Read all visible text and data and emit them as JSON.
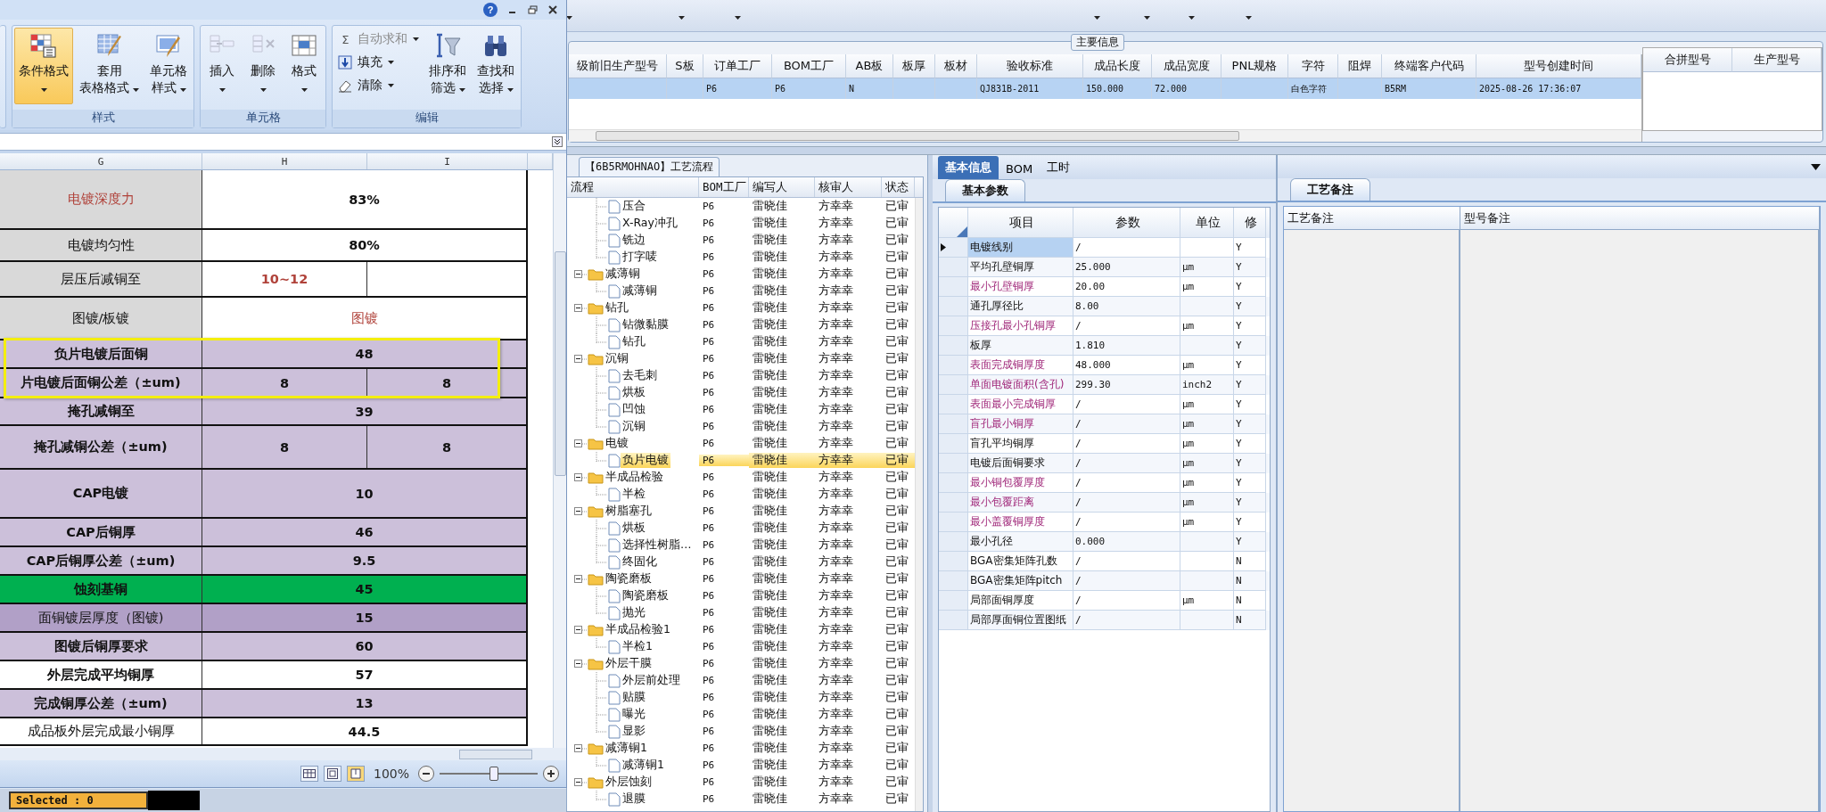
{
  "main": {
    "group_title": "主要信息",
    "columns": [
      {
        "header": "级前旧生产型号"
      },
      {
        "header": "S板"
      },
      {
        "header": "订单工厂",
        "value": "P6"
      },
      {
        "header": "BOM工厂",
        "value": "P6"
      },
      {
        "header": "AB板",
        "value": "N"
      },
      {
        "header": "板厚"
      },
      {
        "header": "板材"
      },
      {
        "header": "验收标准",
        "value": "QJ831B-2011"
      },
      {
        "header": "成品长度",
        "value": "150.000"
      },
      {
        "header": "成品宽度",
        "value": "72.000"
      },
      {
        "header": "PNL规格"
      },
      {
        "header": "字符",
        "value": "白色字符"
      },
      {
        "header": "阻焊"
      },
      {
        "header": "终端客户代码",
        "value": "B5RM"
      },
      {
        "header": "型号创建时间",
        "value": "2025-08-26 17:36:07"
      }
    ],
    "data_row_selected": true,
    "side_columns": [
      "合拼型号",
      "生产型号"
    ],
    "status_text": "Selected : 0"
  },
  "tree": {
    "tab": "【6B5RMOHNAO】工艺流程",
    "columns": [
      "流程",
      "BOM工厂",
      "编写人",
      "核审人",
      "状态"
    ],
    "leading_children": [
      {
        "label": "压合",
        "bom": "P6",
        "writer": "雷晓佳",
        "reviewer": "方幸幸",
        "status": "已审",
        "selected": false
      },
      {
        "label": "X-Ray冲孔",
        "bom": "P6",
        "writer": "雷晓佳",
        "reviewer": "方幸幸",
        "status": "已审",
        "selected": false
      },
      {
        "label": "铣边",
        "bom": "P6",
        "writer": "雷晓佳",
        "reviewer": "方幸幸",
        "status": "已审",
        "selected": false
      },
      {
        "label": "打字唛",
        "bom": "P6",
        "writer": "雷晓佳",
        "reviewer": "方幸幸",
        "status": "已审",
        "selected": false
      }
    ],
    "nodes": [
      {
        "label": "减薄铜",
        "bom": "P6",
        "writer": "雷晓佳",
        "reviewer": "方幸幸",
        "status": "已审",
        "selected": false,
        "expanded": true,
        "children": [
          {
            "label": "减薄铜",
            "bom": "P6",
            "writer": "雷晓佳",
            "reviewer": "方幸幸",
            "status": "已审",
            "selected": false
          }
        ]
      },
      {
        "label": "钻孔",
        "bom": "P6",
        "writer": "雷晓佳",
        "reviewer": "方幸幸",
        "status": "已审",
        "selected": false,
        "expanded": true,
        "children": [
          {
            "label": "钻微黏膜",
            "bom": "P6",
            "writer": "雷晓佳",
            "reviewer": "方幸幸",
            "status": "已审",
            "selected": false
          },
          {
            "label": "钻孔",
            "bom": "P6",
            "writer": "雷晓佳",
            "reviewer": "方幸幸",
            "status": "已审",
            "selected": false
          }
        ]
      },
      {
        "label": "沉铜",
        "bom": "P6",
        "writer": "雷晓佳",
        "reviewer": "方幸幸",
        "status": "已审",
        "selected": false,
        "expanded": true,
        "children": [
          {
            "label": "去毛刺",
            "bom": "P6",
            "writer": "雷晓佳",
            "reviewer": "方幸幸",
            "status": "已审",
            "selected": false
          },
          {
            "label": "烘板",
            "bom": "P6",
            "writer": "雷晓佳",
            "reviewer": "方幸幸",
            "status": "已审",
            "selected": false
          },
          {
            "label": "凹蚀",
            "bom": "P6",
            "writer": "雷晓佳",
            "reviewer": "方幸幸",
            "status": "已审",
            "selected": false
          },
          {
            "label": "沉铜",
            "bom": "P6",
            "writer": "雷晓佳",
            "reviewer": "方幸幸",
            "status": "已审",
            "selected": false
          }
        ]
      },
      {
        "label": "电镀",
        "bom": "P6",
        "writer": "雷晓佳",
        "reviewer": "方幸幸",
        "status": "已审",
        "selected": false,
        "expanded": true,
        "children": [
          {
            "label": "负片电镀",
            "bom": "P6",
            "writer": "雷晓佳",
            "reviewer": "方幸幸",
            "status": "已审",
            "selected": true
          }
        ]
      },
      {
        "label": "半成品检验",
        "bom": "P6",
        "writer": "雷晓佳",
        "reviewer": "方幸幸",
        "status": "已审",
        "selected": false,
        "expanded": true,
        "children": [
          {
            "label": "半检",
            "bom": "P6",
            "writer": "雷晓佳",
            "reviewer": "方幸幸",
            "status": "已审",
            "selected": false
          }
        ]
      },
      {
        "label": "树脂塞孔",
        "bom": "P6",
        "writer": "雷晓佳",
        "reviewer": "方幸幸",
        "status": "已审",
        "selected": false,
        "expanded": true,
        "children": [
          {
            "label": "烘板",
            "bom": "P6",
            "writer": "雷晓佳",
            "reviewer": "方幸幸",
            "status": "已审",
            "selected": false
          },
          {
            "label": "选择性树脂…",
            "bom": "P6",
            "writer": "雷晓佳",
            "reviewer": "方幸幸",
            "status": "已审",
            "selected": false
          },
          {
            "label": "终固化",
            "bom": "P6",
            "writer": "雷晓佳",
            "reviewer": "方幸幸",
            "status": "已审",
            "selected": false
          }
        ]
      },
      {
        "label": "陶瓷磨板",
        "bom": "P6",
        "writer": "雷晓佳",
        "reviewer": "方幸幸",
        "status": "已审",
        "selected": false,
        "expanded": true,
        "children": [
          {
            "label": "陶瓷磨板",
            "bom": "P6",
            "writer": "雷晓佳",
            "reviewer": "方幸幸",
            "status": "已审",
            "selected": false
          },
          {
            "label": "抛光",
            "bom": "P6",
            "writer": "雷晓佳",
            "reviewer": "方幸幸",
            "status": "已审",
            "selected": false
          }
        ]
      },
      {
        "label": "半成品检验1",
        "bom": "P6",
        "writer": "雷晓佳",
        "reviewer": "方幸幸",
        "status": "已审",
        "selected": false,
        "expanded": true,
        "children": [
          {
            "label": "半检1",
            "bom": "P6",
            "writer": "雷晓佳",
            "reviewer": "方幸幸",
            "status": "已审",
            "selected": false
          }
        ]
      },
      {
        "label": "外层干膜",
        "bom": "P6",
        "writer": "雷晓佳",
        "reviewer": "方幸幸",
        "status": "已审",
        "selected": false,
        "expanded": true,
        "children": [
          {
            "label": "外层前处理",
            "bom": "P6",
            "writer": "雷晓佳",
            "reviewer": "方幸幸",
            "status": "已审",
            "selected": false
          },
          {
            "label": "贴膜",
            "bom": "P6",
            "writer": "雷晓佳",
            "reviewer": "方幸幸",
            "status": "已审",
            "selected": false
          },
          {
            "label": "曝光",
            "bom": "P6",
            "writer": "雷晓佳",
            "reviewer": "方幸幸",
            "status": "已审",
            "selected": false
          },
          {
            "label": "显影",
            "bom": "P6",
            "writer": "雷晓佳",
            "reviewer": "方幸幸",
            "status": "已审",
            "selected": false
          }
        ]
      },
      {
        "label": "减薄铜1",
        "bom": "P6",
        "writer": "雷晓佳",
        "reviewer": "方幸幸",
        "status": "已审",
        "selected": false,
        "expanded": true,
        "children": [
          {
            "label": "减薄铜1",
            "bom": "P6",
            "writer": "雷晓佳",
            "reviewer": "方幸幸",
            "status": "已审",
            "selected": false
          }
        ]
      },
      {
        "label": "外层蚀刻",
        "bom": "P6",
        "writer": "雷晓佳",
        "reviewer": "方幸幸",
        "status": "已审",
        "selected": false,
        "expanded": true,
        "children": [
          {
            "label": "退膜",
            "bom": "P6",
            "writer": "雷晓佳",
            "reviewer": "方幸幸",
            "status": "已审",
            "selected": false
          }
        ]
      }
    ]
  },
  "info": {
    "tabs": [
      {
        "label": "基本信息",
        "selected": true
      },
      {
        "label": "BOM",
        "selected": false
      },
      {
        "label": "工时",
        "selected": false
      }
    ],
    "subtab": "基本参数",
    "columns": [
      "项目",
      "参数",
      "单位",
      "修"
    ],
    "rows": [
      {
        "item": "电镀线别",
        "value": "/",
        "modify": "Y",
        "highlighted": false,
        "selected": true
      },
      {
        "item": "平均孔壁铜厚",
        "value": "25.000",
        "unit": "μm",
        "modify": "Y",
        "highlighted": false,
        "selected": false
      },
      {
        "item": "最小孔壁铜厚",
        "value": "20.00",
        "unit": "μm",
        "modify": "Y",
        "highlighted": true,
        "selected": false
      },
      {
        "item": "通孔厚径比",
        "value": "8.00",
        "modify": "Y",
        "highlighted": false,
        "selected": false
      },
      {
        "item": "压接孔最小孔铜厚",
        "value": "/",
        "unit": "μm",
        "modify": "Y",
        "highlighted": true,
        "selected": false
      },
      {
        "item": "板厚",
        "value": "1.810",
        "modify": "Y",
        "highlighted": false,
        "selected": false
      },
      {
        "item": "表面完成铜厚度",
        "value": "48.000",
        "unit": "μm",
        "modify": "Y",
        "highlighted": true,
        "selected": false
      },
      {
        "item": "单面电镀面积(含孔)",
        "value": "299.30",
        "unit": "inch2",
        "modify": "Y",
        "highlighted": true,
        "selected": false
      },
      {
        "item": "表面最小完成铜厚",
        "value": "/",
        "unit": "μm",
        "modify": "Y",
        "highlighted": true,
        "selected": false
      },
      {
        "item": "盲孔最小铜厚",
        "value": "/",
        "unit": "μm",
        "modify": "Y",
        "highlighted": true,
        "selected": false
      },
      {
        "item": "盲孔平均铜厚",
        "value": "/",
        "unit": "μm",
        "modify": "Y",
        "highlighted": false,
        "selected": false
      },
      {
        "item": "电镀后面铜要求",
        "value": "/",
        "unit": "μm",
        "modify": "Y",
        "highlighted": false,
        "selected": false
      },
      {
        "item": "最小铜包覆厚度",
        "value": "/",
        "unit": "μm",
        "modify": "Y",
        "highlighted": true,
        "selected": false
      },
      {
        "item": "最小包覆距离",
        "value": "/",
        "unit": "μm",
        "modify": "Y",
        "highlighted": true,
        "selected": false
      },
      {
        "item": "最小盖覆铜厚度",
        "value": "/",
        "unit": "μm",
        "modify": "Y",
        "highlighted": true,
        "selected": false
      },
      {
        "item": "最小孔径",
        "value": "0.000",
        "modify": "Y",
        "highlighted": false,
        "selected": false
      },
      {
        "item": "BGA密集矩阵孔数",
        "value": "/",
        "modify": "N",
        "highlighted": false,
        "selected": false
      },
      {
        "item": "BGA密集矩阵pitch",
        "value": "/",
        "modify": "N",
        "highlighted": false,
        "selected": false
      },
      {
        "item": "局部面铜厚度",
        "value": "/",
        "unit": "μm",
        "modify": "N",
        "highlighted": false,
        "selected": false
      },
      {
        "item": "局部厚面铜位置图纸",
        "value": "/",
        "modify": "N",
        "highlighted": false,
        "selected": false
      }
    ]
  },
  "notes": {
    "tab": "工艺备注",
    "columns": [
      "工艺备注",
      "型号备注"
    ]
  },
  "excel": {
    "help_glyph": "?",
    "groups": [
      {
        "label": "样式",
        "buttons": [
          {
            "lines": [
              "条件格式"
            ],
            "active": true
          },
          {
            "lines": [
              "套用",
              "表格格式"
            ],
            "active": false
          },
          {
            "lines": [
              "单元格",
              "样式"
            ],
            "active": false
          }
        ]
      },
      {
        "label": "单元格",
        "buttons": [
          {
            "lines": [
              "插入"
            ],
            "active": false
          },
          {
            "lines": [
              "删除"
            ],
            "active": false
          },
          {
            "lines": [
              "格式"
            ],
            "active": false
          }
        ]
      },
      {
        "label": "编辑",
        "small": [
          {
            "glyph": "Σ",
            "label": "自动求和",
            "disabled": true
          },
          {
            "label": "填充",
            "disabled": false
          },
          {
            "label": "清除",
            "disabled": false
          }
        ],
        "buttons": [
          {
            "lines": [
              "排序和",
              "筛选"
            ],
            "active": false
          },
          {
            "lines": [
              "查找和",
              "选择"
            ],
            "active": false
          }
        ]
      }
    ],
    "sheet": {
      "columns": [
        "G",
        "H",
        "I"
      ],
      "rows": [
        {
          "label": "电镀深度力",
          "kind": "merged",
          "values": [
            "83%"
          ],
          "color": "#ffffff",
          "shaded_label": true,
          "bold": false,
          "label_red": true,
          "value_red": false,
          "value_bold": true
        },
        {
          "label": "电镀均匀性",
          "kind": "merged",
          "values": [
            "80%"
          ],
          "color": "#ffffff",
          "shaded_label": true,
          "bold": false,
          "label_red": false,
          "value_red": false,
          "value_bold": true
        },
        {
          "label": "层压后减铜至",
          "kind": "split",
          "values": [
            "10~12"
          ],
          "color": "#ffffff",
          "shaded_label": true,
          "bold": false,
          "label_red": false,
          "value_red": true,
          "value_bold": true
        },
        {
          "label": "图镀/板镀",
          "kind": "merged",
          "values": [
            "图镀"
          ],
          "color": "#ffffff",
          "shaded_label": true,
          "bold": false,
          "label_red": false,
          "value_red": true,
          "value_bold": false
        },
        {
          "label": "负片电镀后面铜",
          "kind": "merged",
          "values": [
            "48"
          ],
          "color": "#ccc0da",
          "shaded_label": false,
          "bold": true,
          "label_red": false,
          "value_red": false,
          "value_bold": true
        },
        {
          "label": "片电镀后面铜公差（±um)",
          "kind": "split",
          "values": [
            "8",
            "8"
          ],
          "color": "#ccc0da",
          "shaded_label": false,
          "bold": true,
          "label_red": false,
          "value_red": false,
          "value_bold": true
        },
        {
          "label": "掩孔减铜至",
          "kind": "merged",
          "values": [
            "39"
          ],
          "color": "#ccc0da",
          "shaded_label": false,
          "bold": true,
          "label_red": false,
          "value_red": false,
          "value_bold": true
        },
        {
          "label": "掩孔减铜公差（±um)",
          "kind": "split",
          "values": [
            "8",
            "8"
          ],
          "color": "#ccc0da",
          "shaded_label": false,
          "bold": true,
          "label_red": false,
          "value_red": false,
          "value_bold": true
        },
        {
          "label": "CAP电镀",
          "kind": "merged",
          "values": [
            "10"
          ],
          "color": "#ccc0da",
          "shaded_label": false,
          "bold": true,
          "label_red": false,
          "value_red": false,
          "value_bold": true
        },
        {
          "label": "CAP后铜厚",
          "kind": "merged",
          "values": [
            "46"
          ],
          "color": "#ccc0da",
          "shaded_label": false,
          "bold": true,
          "label_red": false,
          "value_red": false,
          "value_bold": true
        },
        {
          "label": "CAP后铜厚公差（±um)",
          "kind": "merged",
          "values": [
            "9.5"
          ],
          "color": "#ccc0da",
          "shaded_label": false,
          "bold": true,
          "label_red": false,
          "value_red": false,
          "value_bold": true
        },
        {
          "label": "蚀刻基铜",
          "kind": "merged",
          "values": [
            "45"
          ],
          "color": "#00b050",
          "shaded_label": false,
          "bold": true,
          "label_red": false,
          "value_red": false,
          "value_bold": true
        },
        {
          "label": "面铜镀层厚度（图镀)",
          "kind": "merged",
          "values": [
            "15"
          ],
          "color": "#b1a0c7",
          "shaded_label": false,
          "bold": false,
          "label_red": false,
          "value_red": false,
          "value_bold": true
        },
        {
          "label": "图镀后铜厚要求",
          "kind": "merged",
          "values": [
            "60"
          ],
          "color": "#ccc0da",
          "shaded_label": false,
          "bold": true,
          "label_red": false,
          "value_red": false,
          "value_bold": true
        },
        {
          "label": "外层完成平均铜厚",
          "kind": "merged",
          "values": [
            "57"
          ],
          "color": "#ffffff",
          "shaded_label": false,
          "bold": true,
          "label_red": false,
          "value_red": false,
          "value_bold": true
        },
        {
          "label": "完成铜厚公差（±um)",
          "kind": "merged",
          "values": [
            "13"
          ],
          "color": "#ccc0da",
          "shaded_label": false,
          "bold": true,
          "label_red": false,
          "value_red": false,
          "value_bold": true
        },
        {
          "label": "成品板外层完成最小铜厚",
          "kind": "merged",
          "values": [
            "44.5"
          ],
          "color": "#ffffff",
          "shaded_label": false,
          "bold": false,
          "label_red": false,
          "value_red": false,
          "value_bold": true
        }
      ]
    },
    "zoom": {
      "reading": "100%",
      "level": 0.55
    }
  }
}
